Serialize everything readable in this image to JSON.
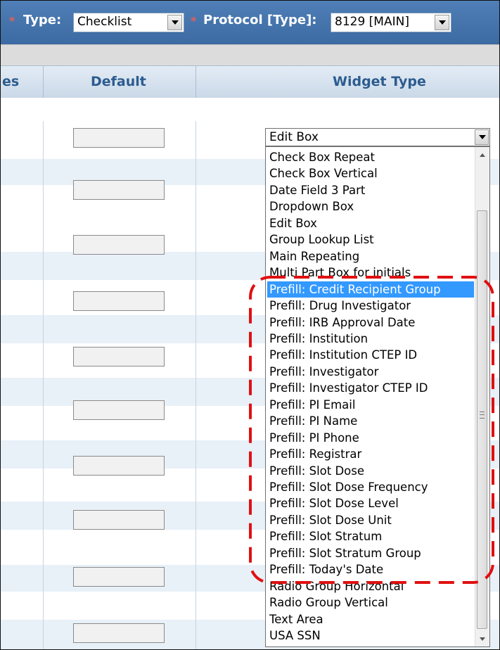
{
  "toolbar": {
    "required_marker": "*",
    "type_label": "Type:",
    "type_value": "Checklist",
    "protocol_label": "Protocol [Type]:",
    "protocol_value": "8129 [MAIN]"
  },
  "table": {
    "headers": [
      "es",
      "Default",
      "Widget Type"
    ]
  },
  "widget_select": {
    "value": "Edit Box"
  },
  "dropdown": {
    "selected_index": 8,
    "options": [
      "Check Box Repeat",
      "Check Box Vertical",
      "Date Field 3 Part",
      "Dropdown Box",
      "Edit Box",
      "Group Lookup List",
      "Main Repeating",
      "Multi Part Box for initials",
      "Prefill: Credit Recipient Group",
      "Prefill: Drug Investigator",
      "Prefill: IRB Approval Date",
      "Prefill: Institution",
      "Prefill: Institution CTEP ID",
      "Prefill: Investigator",
      "Prefill: Investigator CTEP ID",
      "Prefill: PI Email",
      "Prefill: PI Name",
      "Prefill: PI Phone",
      "Prefill: Registrar",
      "Prefill: Slot Dose",
      "Prefill: Slot Dose Frequency",
      "Prefill: Slot Dose Level",
      "Prefill: Slot Dose Unit",
      "Prefill: Slot Stratum",
      "Prefill: Slot Stratum Group",
      "Prefill: Today's Date",
      "Radio Group Horizontal",
      "Radio Group Vertical",
      "Text Area",
      "USA SSN"
    ]
  },
  "colors": {
    "header_bar": "#3c6aa2",
    "required_marker": "#e0605c",
    "column_header_text": "#2c5c8f",
    "selected_option_bg": "#3399ff",
    "annotation": "#e01010"
  }
}
